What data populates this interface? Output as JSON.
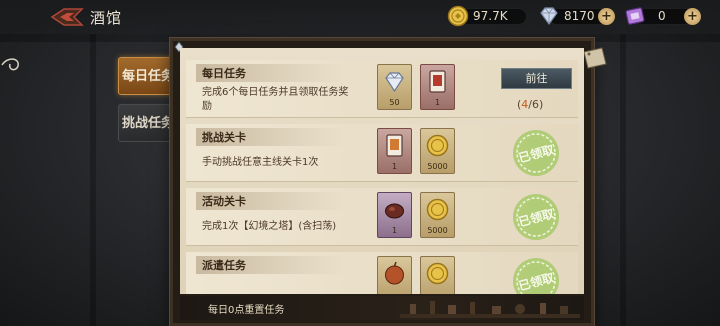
{
  "header": {
    "title": "酒馆"
  },
  "resources": [
    {
      "name": "gold",
      "icon": "gold-coin-icon",
      "value": "97.7K"
    },
    {
      "name": "diamond",
      "icon": "diamond-icon",
      "value": "8170"
    },
    {
      "name": "ticket",
      "icon": "purple-ticket-icon",
      "value": "0"
    }
  ],
  "tabs": [
    {
      "label": "每日任务",
      "active": true
    },
    {
      "label": "挑战任务",
      "active": false
    }
  ],
  "tasks": [
    {
      "title": "每日任务",
      "desc": "完成6个每日任务并且领取任务奖励",
      "rewards": [
        {
          "icon": "diamond-icon",
          "count": "50"
        },
        {
          "icon": "card-icon",
          "count": "1"
        }
      ],
      "action": "前往",
      "progress_current": "4",
      "progress_total": "6",
      "claimed": false
    },
    {
      "title": "挑战关卡",
      "desc": "手动挑战任意主线关卡1次",
      "rewards": [
        {
          "icon": "card-icon",
          "count": "1"
        },
        {
          "icon": "gold-coin-icon",
          "count": "5000"
        }
      ],
      "stamp": "已领取",
      "claimed": true
    },
    {
      "title": "活动关卡",
      "desc": "完成1次【幻境之塔】(含扫荡)",
      "rewards": [
        {
          "icon": "food-icon",
          "count": "1"
        },
        {
          "icon": "gold-coin-icon",
          "count": "5000"
        }
      ],
      "stamp": "已领取",
      "claimed": true
    },
    {
      "title": "派遣任务",
      "desc": "",
      "rewards": [
        {
          "icon": "apple-icon",
          "count": ""
        },
        {
          "icon": "gold-coin-icon",
          "count": ""
        }
      ],
      "stamp": "已领取",
      "claimed": true
    }
  ],
  "footer": {
    "reset_text": "每日0点重置任务"
  },
  "colors": {
    "active_tab": "#a26a2c",
    "go_button": "#3d4952",
    "progress_current": "#c05a18",
    "stamp_green": "#8fb84a"
  }
}
